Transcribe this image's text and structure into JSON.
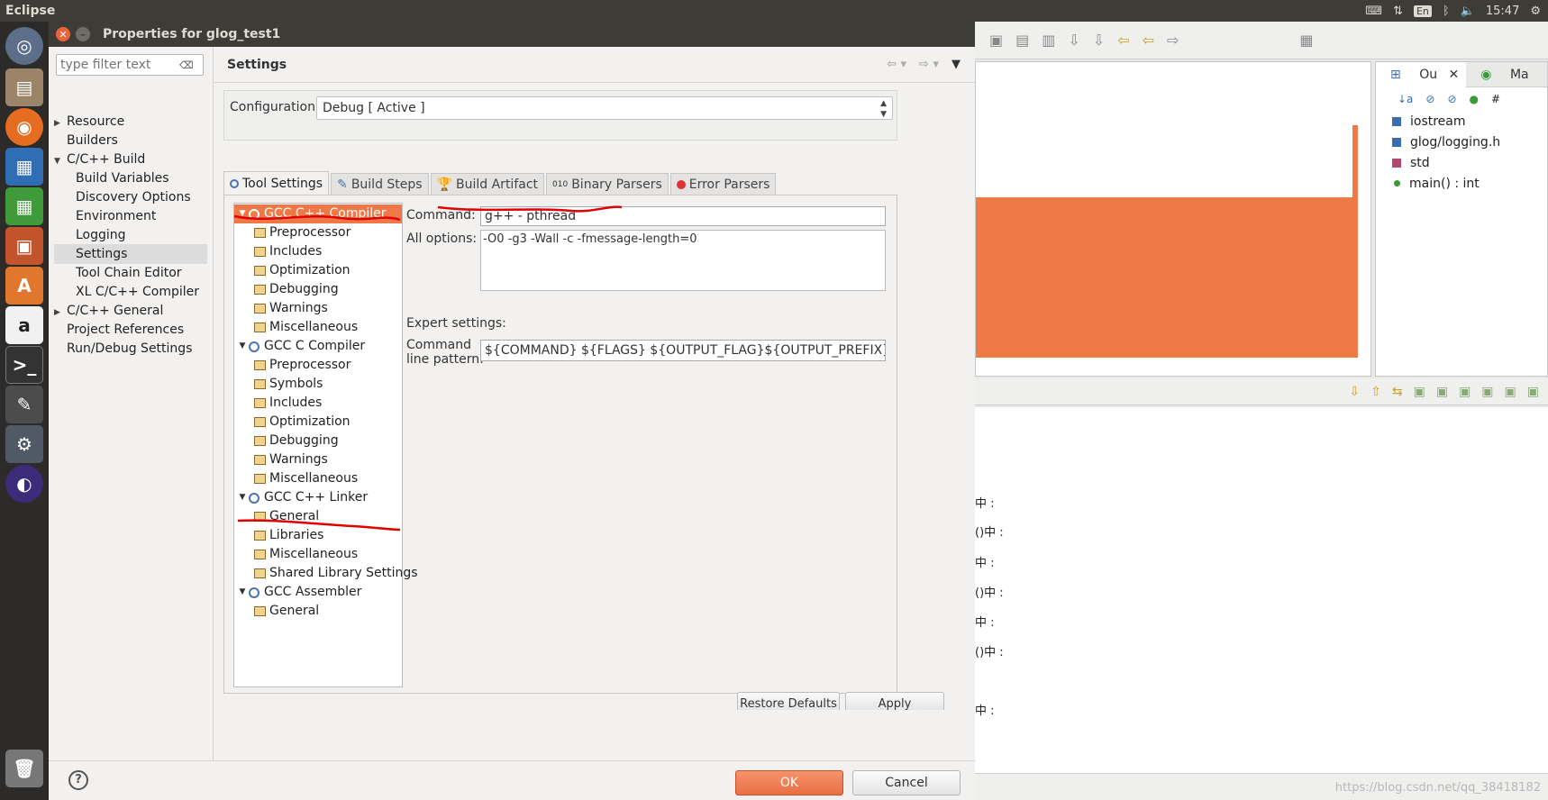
{
  "topbar": {
    "app_name": "Eclipse",
    "lang": "En",
    "time": "15:47"
  },
  "launcher": {
    "items": [
      "ubuntu-dash",
      "files",
      "firefox",
      "writer",
      "calc",
      "impress",
      "software-center",
      "amazon",
      "terminal",
      "text-editor",
      "system-settings",
      "eclipse",
      "trash"
    ]
  },
  "dialog": {
    "title": "Properties for glog_test1",
    "filter_placeholder": "type filter text",
    "nav": [
      {
        "label": "Resource",
        "arrow": "▶"
      },
      {
        "label": "Builders",
        "arrow": ""
      },
      {
        "label": "C/C++ Build",
        "arrow": "▼"
      },
      {
        "label": "Build Variables",
        "arrow": ""
      },
      {
        "label": "Discovery Options",
        "arrow": ""
      },
      {
        "label": "Environment",
        "arrow": ""
      },
      {
        "label": "Logging",
        "arrow": ""
      },
      {
        "label": "Settings",
        "arrow": ""
      },
      {
        "label": "Tool Chain Editor",
        "arrow": ""
      },
      {
        "label": "XL C/C++ Compiler",
        "arrow": ""
      },
      {
        "label": "C/C++ General",
        "arrow": "▶"
      },
      {
        "label": "Project References",
        "arrow": ""
      },
      {
        "label": "Run/Debug Settings",
        "arrow": ""
      }
    ],
    "page_title": "Settings",
    "config_label": "Configuration:",
    "config_value": "Debug  [ Active ]",
    "tabs": [
      "Tool Settings",
      "Build Steps",
      "Build Artifact",
      "Binary Parsers",
      "Error Parsers"
    ],
    "tree": [
      {
        "label": "GCC C++ Compiler",
        "type": "tool"
      },
      {
        "label": "Preprocessor",
        "type": "opt"
      },
      {
        "label": "Includes",
        "type": "opt"
      },
      {
        "label": "Optimization",
        "type": "opt"
      },
      {
        "label": "Debugging",
        "type": "opt"
      },
      {
        "label": "Warnings",
        "type": "opt"
      },
      {
        "label": "Miscellaneous",
        "type": "opt"
      },
      {
        "label": "GCC C Compiler",
        "type": "tool"
      },
      {
        "label": "Preprocessor",
        "type": "opt"
      },
      {
        "label": "Symbols",
        "type": "opt"
      },
      {
        "label": "Includes",
        "type": "opt"
      },
      {
        "label": "Optimization",
        "type": "opt"
      },
      {
        "label": "Debugging",
        "type": "opt"
      },
      {
        "label": "Warnings",
        "type": "opt"
      },
      {
        "label": "Miscellaneous",
        "type": "opt"
      },
      {
        "label": "GCC C++ Linker",
        "type": "tool"
      },
      {
        "label": "General",
        "type": "opt"
      },
      {
        "label": "Libraries",
        "type": "opt"
      },
      {
        "label": "Miscellaneous",
        "type": "opt"
      },
      {
        "label": "Shared Library Settings",
        "type": "opt"
      },
      {
        "label": "GCC Assembler",
        "type": "tool"
      },
      {
        "label": "General",
        "type": "opt"
      }
    ],
    "command_label": "Command:",
    "command_value": "g++ - pthread",
    "all_options_label": "All options:",
    "all_options_value": "-O0 -g3 -Wall -c -fmessage-length=0",
    "expert_label": "Expert settings:",
    "pattern_label_1": "Command",
    "pattern_label_2": "line pattern:",
    "pattern_value": "${COMMAND} ${FLAGS} ${OUTPUT_FLAG}${OUTPUT_PREFIX}${OUTPUT} ${INPUTS}",
    "restore_label": "Restore Defaults",
    "apply_label": "Apply",
    "ok_label": "OK",
    "cancel_label": "Cancel",
    "help_label": "?"
  },
  "background": {
    "outline_tab": "Ou",
    "markers_tab": "Ma",
    "outline_items": [
      "iostream",
      "glog/logging.h",
      "std",
      "main() : int"
    ],
    "console_fragments": [
      "中 :",
      "()中 :",
      "中 :",
      "()中 :",
      "中 :",
      "()中 :",
      "中 :"
    ],
    "watermark": "https://blog.csdn.net/qq_38418182"
  },
  "colors": {
    "accent": "#f07746",
    "annotation": "#e00000"
  }
}
